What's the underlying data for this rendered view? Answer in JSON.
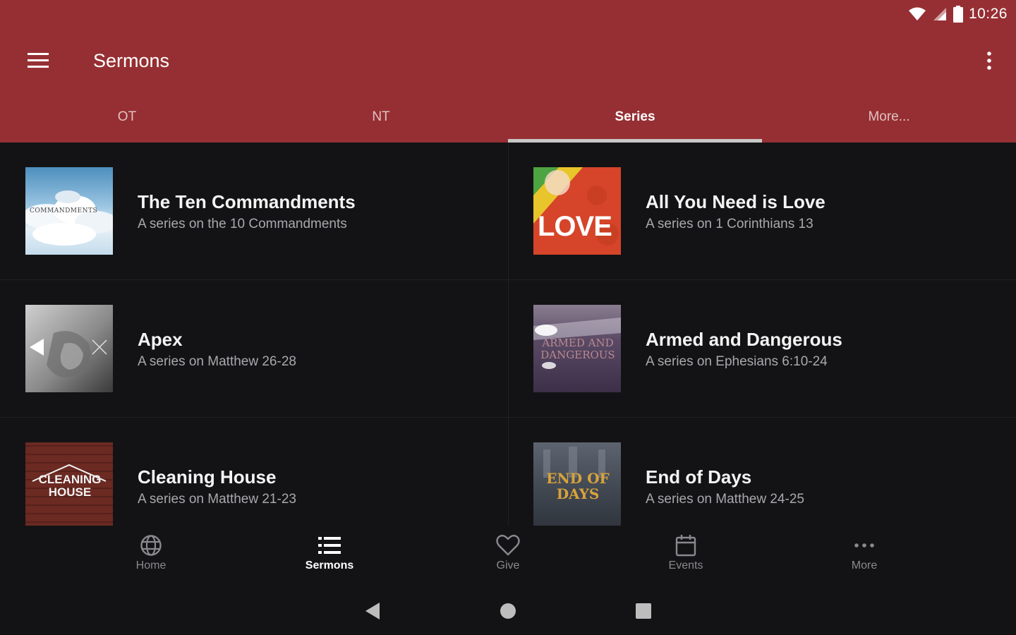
{
  "status_bar": {
    "time": "10:26"
  },
  "toolbar": {
    "title": "Sermons"
  },
  "tabs": [
    {
      "label": "OT",
      "active": false
    },
    {
      "label": "NT",
      "active": false
    },
    {
      "label": "Series",
      "active": true
    },
    {
      "label": "More...",
      "active": false
    }
  ],
  "series": [
    {
      "title": "The Ten Commandments",
      "subtitle": "A series on the 10 Commandments",
      "thumb_text": "COMMANDMENTS"
    },
    {
      "title": "All You Need is Love",
      "subtitle": "A series on 1 Corinthians 13",
      "thumb_text": "LOVE"
    },
    {
      "title": "Apex",
      "subtitle": "A series on Matthew 26-28",
      "thumb_text": ""
    },
    {
      "title": "Armed and Dangerous",
      "subtitle": "A series on Ephesians 6:10-24",
      "thumb_text": "ARMED AND DANGEROUS"
    },
    {
      "title": "Cleaning House",
      "subtitle": "A series on Matthew 21-23",
      "thumb_text": "CLEANING HOUSE"
    },
    {
      "title": "End of Days",
      "subtitle": "A series on Matthew 24-25",
      "thumb_text": "END OF DAYS"
    }
  ],
  "bottom_nav": [
    {
      "label": "Home",
      "icon": "globe-icon",
      "active": false
    },
    {
      "label": "Sermons",
      "icon": "list-icon",
      "active": true
    },
    {
      "label": "Give",
      "icon": "heart-icon",
      "active": false
    },
    {
      "label": "Events",
      "icon": "calendar-icon",
      "active": false
    },
    {
      "label": "More",
      "icon": "more-horiz-icon",
      "active": false
    }
  ],
  "colors": {
    "app_bar": "#962f33",
    "background": "#131315",
    "tab_indicator": "#c8c8c8"
  }
}
